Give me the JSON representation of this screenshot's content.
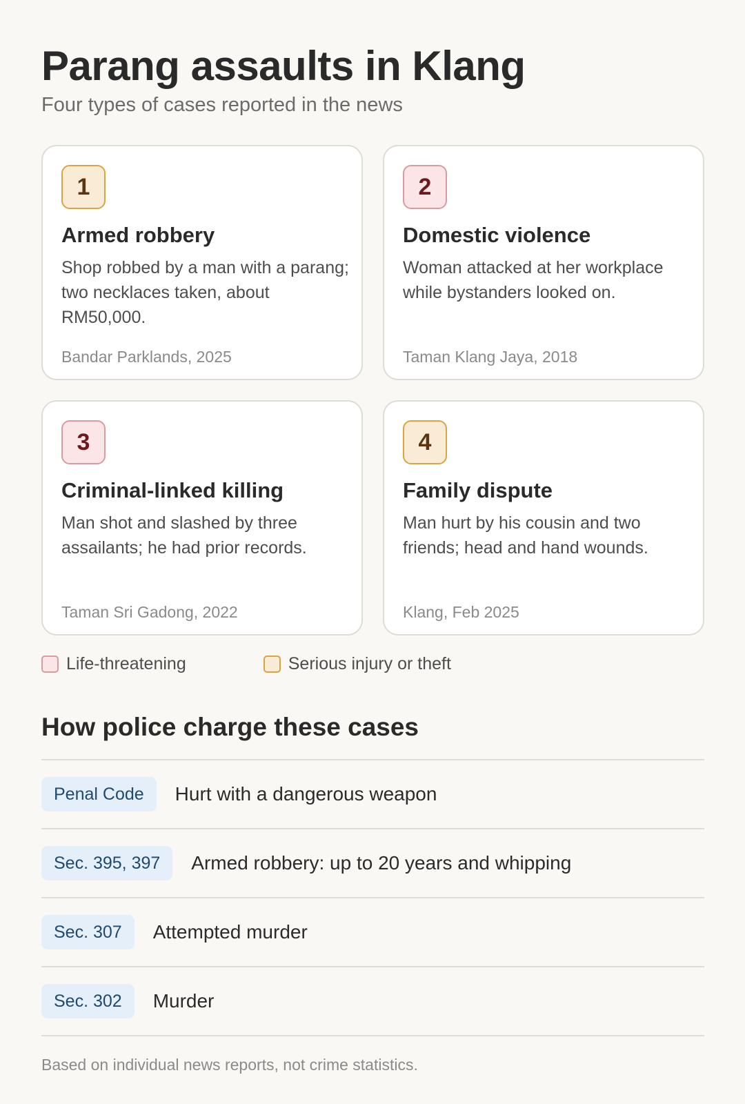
{
  "header": {
    "title": "Parang assaults in Klang",
    "subtitle": "Four types of cases reported in the news"
  },
  "cases": [
    {
      "number": "1",
      "severity": "serious",
      "title": "Armed robbery",
      "description": "Shop robbed by a man with a parang; two necklaces taken, about RM50,000.",
      "location_date": "Bandar Parklands, 2025"
    },
    {
      "number": "2",
      "severity": "life-threatening",
      "title": "Domestic violence",
      "description": "Woman attacked at her workplace while bystanders looked on.",
      "location_date": "Taman Klang Jaya, 2018"
    },
    {
      "number": "3",
      "severity": "life-threatening",
      "title": "Criminal-linked killing",
      "description": "Man shot and slashed by three assailants; he had prior records.",
      "location_date": "Taman Sri Gadong, 2022"
    },
    {
      "number": "4",
      "severity": "serious",
      "title": "Family dispute",
      "description": "Man hurt by his cousin and two friends; head and hand wounds.",
      "location_date": "Klang, Feb 2025"
    }
  ],
  "legend": {
    "life_threatening": "Life-threatening",
    "serious": "Serious injury or theft"
  },
  "colors": {
    "life_threatening_fill": "#fbe5e6",
    "life_threatening_border": "#d99ba1",
    "serious_fill": "#faebd7",
    "serious_border": "#d9a441",
    "tag_fill": "#e5eff9"
  },
  "charges": {
    "title": "How police charge these cases",
    "rows": [
      {
        "tag": "Penal Code",
        "text": "Hurt with a dangerous weapon"
      },
      {
        "tag": "Sec. 395, 397",
        "text": "Armed robbery: up to 20 years and whipping"
      },
      {
        "tag": "Sec. 307",
        "text": "Attempted murder"
      },
      {
        "tag": "Sec. 302",
        "text": "Murder"
      }
    ]
  },
  "footnote": "Based on individual news reports, not crime statistics."
}
